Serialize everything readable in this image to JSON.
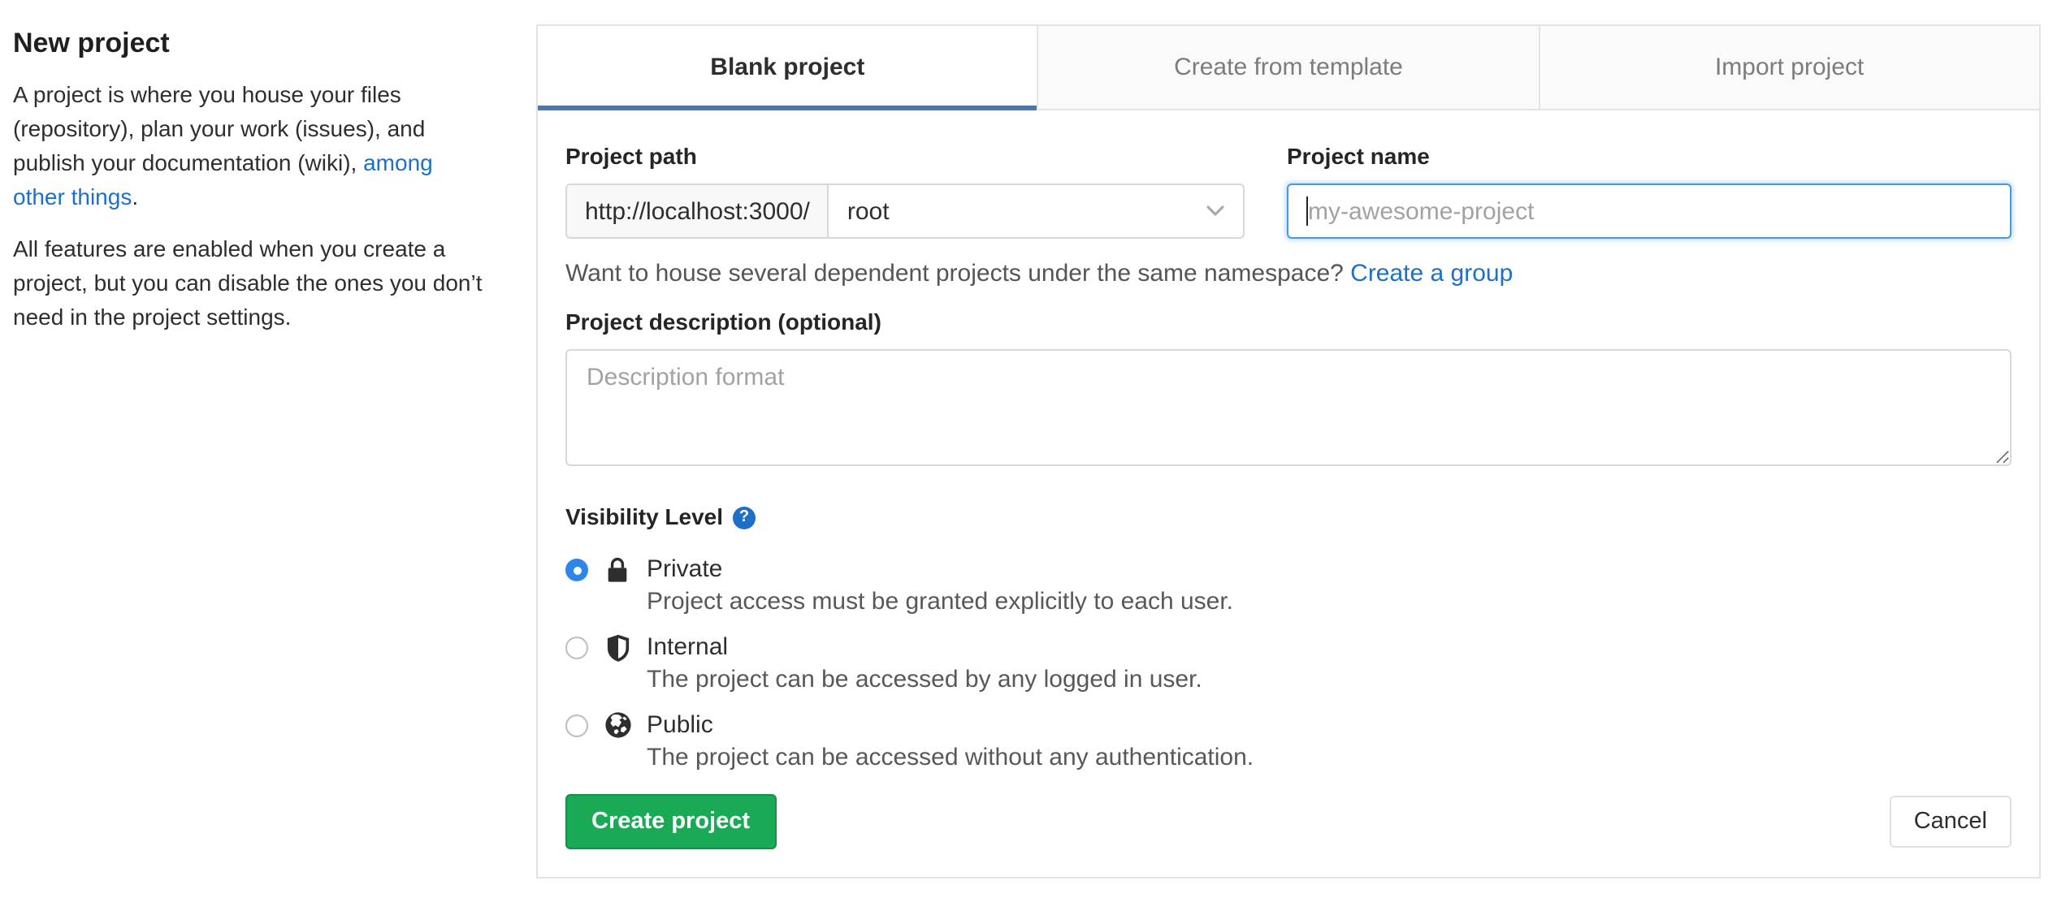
{
  "sidebar": {
    "title": "New project",
    "intro": {
      "text_before": "A project is where you house your files (repository), plan your work (issues), and publish your documentation (wiki), ",
      "link_text": "among other things",
      "text_after": "."
    },
    "features_note": "All features are enabled when you create a project, but you can disable the ones you don’t need in the project settings."
  },
  "tabs": [
    {
      "label": "Blank project",
      "active": true
    },
    {
      "label": "Create from template",
      "active": false
    },
    {
      "label": "Import project",
      "active": false
    }
  ],
  "form": {
    "project_path": {
      "label": "Project path",
      "url_prefix": "http://localhost:3000/",
      "namespace_selected": "root"
    },
    "project_name": {
      "label": "Project name",
      "placeholder": "my-awesome-project",
      "value": ""
    },
    "namespace_help": {
      "text_before": "Want to house several dependent projects under the same namespace? ",
      "link_text": "Create a group"
    },
    "description": {
      "label": "Project description (optional)",
      "placeholder": "Description format"
    },
    "visibility": {
      "label": "Visibility Level",
      "help_glyph": "?",
      "options": [
        {
          "name": "Private",
          "description": "Project access must be granted explicitly to each user.",
          "icon": "lock-icon",
          "selected": true
        },
        {
          "name": "Internal",
          "description": "The project can be accessed by any logged in user.",
          "icon": "shield-icon",
          "selected": false
        },
        {
          "name": "Public",
          "description": "The project can be accessed without any authentication.",
          "icon": "globe-icon",
          "selected": false
        }
      ]
    },
    "submit_label": "Create project",
    "cancel_label": "Cancel"
  },
  "colors": {
    "link": "#1d6fc8",
    "tab_active_underline": "#4a79a8",
    "radio_selected": "#2e87e8",
    "focus_border": "#459ae7",
    "create_button": "#1aaa55",
    "panel_border": "#e3e3e3",
    "inactive_tab_bg": "#fafafa"
  }
}
